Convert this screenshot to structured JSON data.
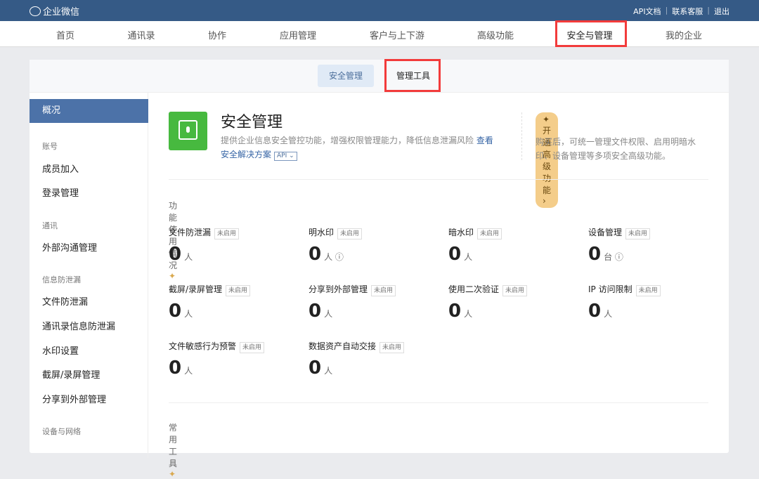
{
  "topbar": {
    "logo": "企业微信",
    "links": [
      "API文档",
      "联系客服",
      "退出"
    ]
  },
  "nav": [
    "首页",
    "通讯录",
    "协作",
    "应用管理",
    "客户与上下游",
    "高级功能",
    "安全与管理",
    "我的企业"
  ],
  "tabs": [
    "安全管理",
    "管理工具"
  ],
  "sidebar": {
    "selected": "概况",
    "groups": [
      {
        "title": "账号",
        "items": [
          "成员加入",
          "登录管理"
        ]
      },
      {
        "title": "通讯",
        "items": [
          "外部沟通管理"
        ]
      },
      {
        "title": "信息防泄漏",
        "items": [
          "文件防泄漏",
          "通讯录信息防泄漏",
          "水印设置",
          "截屏/录屏管理",
          "分享到外部管理"
        ]
      },
      {
        "title": "设备与网络",
        "items": []
      }
    ]
  },
  "header": {
    "title": "安全管理",
    "desc": "提供企业信息安全管控功能，增强权限管理能力，降低信息泄漏风险",
    "link": "查看安全解决方案",
    "api": "API ⌄",
    "upgrade": "开通高级功能 ›",
    "upgrade_desc": "购买后，可统一管理文件权限、启用明暗水印、设备管理等多项安全高级功能。"
  },
  "usage": {
    "title": "功能使用情况",
    "stats": [
      {
        "label": "文件防泄漏",
        "badge": "未启用",
        "value": "0",
        "unit": "人"
      },
      {
        "label": "明水印",
        "badge": "未启用",
        "value": "0",
        "unit": "人 ⓘ"
      },
      {
        "label": "暗水印",
        "badge": "未启用",
        "value": "0",
        "unit": "人"
      },
      {
        "label": "设备管理",
        "badge": "未启用",
        "value": "0",
        "unit": "台 ⓘ"
      },
      {
        "label": "截屏/录屏管理",
        "badge": "未启用",
        "value": "0",
        "unit": "人"
      },
      {
        "label": "分享到外部管理",
        "badge": "未启用",
        "value": "0",
        "unit": "人"
      },
      {
        "label": "使用二次验证",
        "badge": "未启用",
        "value": "0",
        "unit": "人"
      },
      {
        "label": "IP 访问限制",
        "badge": "未启用",
        "value": "0",
        "unit": "人"
      },
      {
        "label": "文件敏感行为预警",
        "badge": "未启用",
        "value": "0",
        "unit": "人"
      },
      {
        "label": "数据资产自动交接",
        "badge": "未启用",
        "value": "0",
        "unit": "人"
      }
    ]
  },
  "tools": {
    "title": "常用工具"
  }
}
